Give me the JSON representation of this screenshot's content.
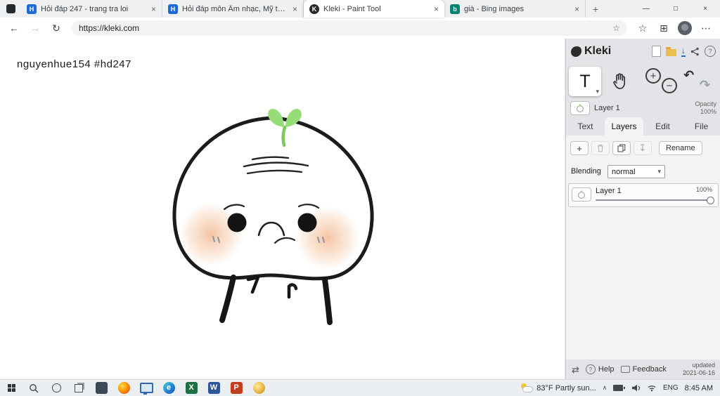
{
  "icons": {
    "tab_close": "×",
    "window_minimize": "—",
    "window_maximize": "□",
    "window_close": "×",
    "nav_back": "←",
    "nav_forward": "→",
    "nav_refresh": "↻",
    "favorite_star": "☆",
    "collections": "⊞",
    "menu_dots": "⋯",
    "new_tab": "+",
    "chevron_down": "▾",
    "text_tool": "T",
    "zoom_in": "+",
    "zoom_out": "−",
    "undo": "↶",
    "redo": "↷",
    "add": "+",
    "merge_down": "↧",
    "question": "?",
    "swap": "⇄",
    "tray_chevron": "∧",
    "edge_letter": "e",
    "excel_letter": "X",
    "word_letter": "W",
    "powerpoint_letter": "P"
  },
  "colors": {
    "favicon_blue": "#1e6bd6",
    "excel_green": "#1d6f42",
    "word_blue": "#2b579a",
    "powerpoint_orange": "#c43e1c",
    "folder_yellow": "#eebd4e",
    "save_blue": "#2b6fb3",
    "sprout_green": "#97dd77"
  },
  "browser": {
    "tabs": [
      {
        "title": "Hỏi đáp 247 - trang tra loi",
        "favicon": "H"
      },
      {
        "title": "Hỏi đáp môn Âm nhạc, Mỹ thuậ...",
        "favicon": "H"
      },
      {
        "title": "Kleki - Paint Tool",
        "favicon": "K"
      },
      {
        "title": "già - Bing images",
        "favicon": "b"
      }
    ],
    "address": "https://kleki.com"
  },
  "canvas": {
    "watermark": "nguyenhue154  #hd247"
  },
  "kleki": {
    "app_name": "Kleki",
    "quick_layer": {
      "name": "Layer 1",
      "opacity_label": "Opacity",
      "opacity_value": "100%"
    },
    "tabs": [
      {
        "label": "Text"
      },
      {
        "label": "Layers"
      },
      {
        "label": "Edit"
      },
      {
        "label": "File"
      }
    ],
    "rename_button": "Rename",
    "blending_label": "Blending",
    "blending_value": "normal",
    "layers": [
      {
        "name": "Layer 1",
        "opacity": "100%"
      }
    ],
    "footer": {
      "help": "Help",
      "feedback": "Feedback",
      "updated_label": "updated",
      "updated_date": "2021-06-16"
    }
  },
  "taskbar": {
    "weather": "83°F Partly sun...",
    "language": "ENG",
    "time": "8:45 AM"
  }
}
